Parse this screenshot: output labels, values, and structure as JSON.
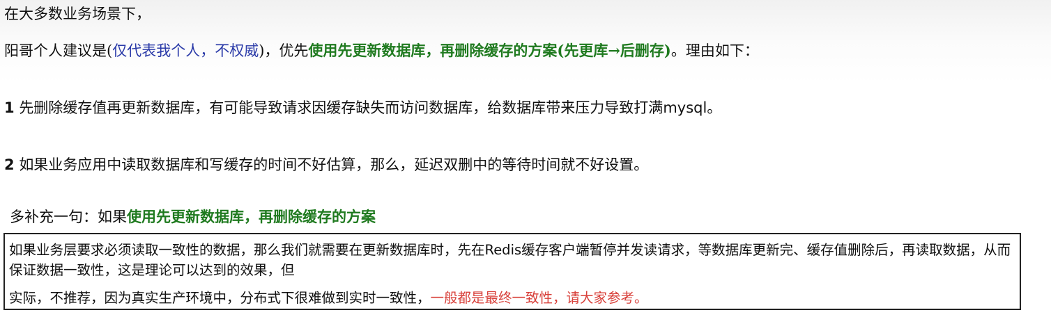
{
  "intro": "在大多数业务场景下，",
  "recommendation": {
    "prefix": "阳哥个人建议是(",
    "disclaimer": "仅代表我个人，不权威",
    "middle": ")，优先",
    "scheme": "使用先更新数据库，再删除缓存的方案(先更库→后删存)",
    "suffix": "。理由如下："
  },
  "reasons": [
    {
      "num": "1",
      "text": "先删除缓存值再更新数据库，有可能导致请求因缓存缺失而访问数据库，给数据库带来压力导致打满",
      "tail": "mysql",
      "end": "。"
    },
    {
      "num": "2",
      "text": "如果业务应用中读取数据库和写缓存的时间不好估算，那么，延迟双删中的等待时间就不好设置。"
    }
  ],
  "supplement": {
    "prefix": "多补充一句：如果",
    "scheme": "使用先更新数据库，再删除缓存的方案"
  },
  "note_box": {
    "p1_a": "如果业务层要求必须读取一致性的数据，那么我们就需要在更新数据库时，先在",
    "p1_redis": "Redis",
    "p1_b": "缓存客户端暂停并发读请求，等数据库更新完、缓存值删除后，再读取数据，从而保证数据一致性，这是理论可以达到的效果，但",
    "p2_a": "实际，不推荐，因为真实生产环境中，分布式下很难做到实时一致性，",
    "p2_red": "一般都是最终一致性，请大家参考。"
  },
  "colors": {
    "blue": "#2a3aa8",
    "green": "#1f7a1f",
    "red": "#d8403a"
  }
}
